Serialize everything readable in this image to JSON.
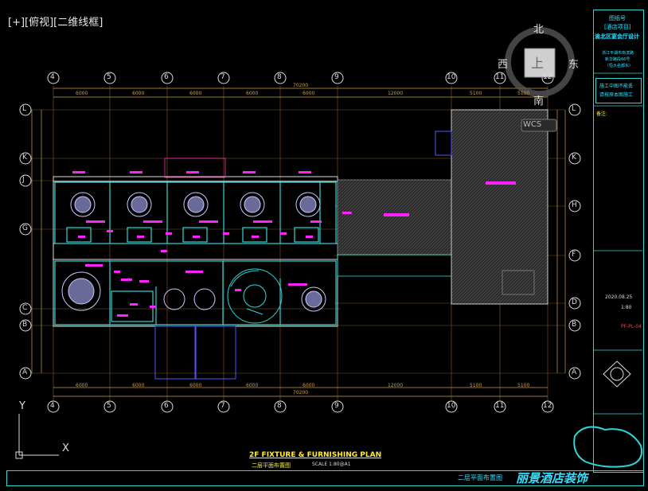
{
  "viewport": {
    "label": "[+][俯视][二维线框]"
  },
  "viewcube": {
    "north": "北",
    "south": "南",
    "east": "东",
    "west": "西",
    "top": "上",
    "wcs": "WCS"
  },
  "axes": {
    "top_numbers": [
      "4",
      "5",
      "6",
      "7",
      "8",
      "9",
      "10",
      "11",
      "12"
    ],
    "left_letters": [
      "L",
      "K",
      "J",
      "G",
      "C",
      "B",
      "A"
    ],
    "right_letters": [
      "L",
      "K",
      "H",
      "F",
      "D",
      "B",
      "A"
    ],
    "dim_overall": "70200",
    "dim_segments": [
      "6000",
      "6000",
      "6000",
      "6000",
      "6000",
      "12000",
      "5100",
      "5100"
    ],
    "left_dims": [
      "5000",
      "2400",
      "5000",
      "3400",
      "2400",
      "5000"
    ],
    "right_dims": [
      "5000",
      "2400",
      "5000",
      "5000",
      "3000",
      "2400",
      "5000"
    ]
  },
  "title_block": {
    "project_line1": "图纸号",
    "project_line2": "[酒店项目]",
    "project_line3": "渝北区宴会厅设计",
    "address_line1": "浙江平湖市南滨路",
    "address_line2": "新华路段66号",
    "address_line3": "（恒大名都东）",
    "notice_line1": "施工中图不能丢",
    "notice_line2": "请按原本图施工",
    "remark_label": "备注:",
    "date": "2020.08.25",
    "scale": "1:80",
    "sheet_no": "PF-PL-04"
  },
  "plan": {
    "title_en": "2F FIXTURE & FURNISHING PLAN",
    "title_cn": "二层平面布置图",
    "scale_text": "SCALE 1:80@A1"
  },
  "ucs": {
    "y": "Y",
    "x": "X"
  },
  "bottom": {
    "sheet_name": "二层平面布置图",
    "brand": "丽景酒店装饰"
  },
  "colors": {
    "cyan": "#2fd6d6",
    "magenta": "#ff22ff",
    "yellow": "#ffee33",
    "grid": "#b07a3a"
  }
}
